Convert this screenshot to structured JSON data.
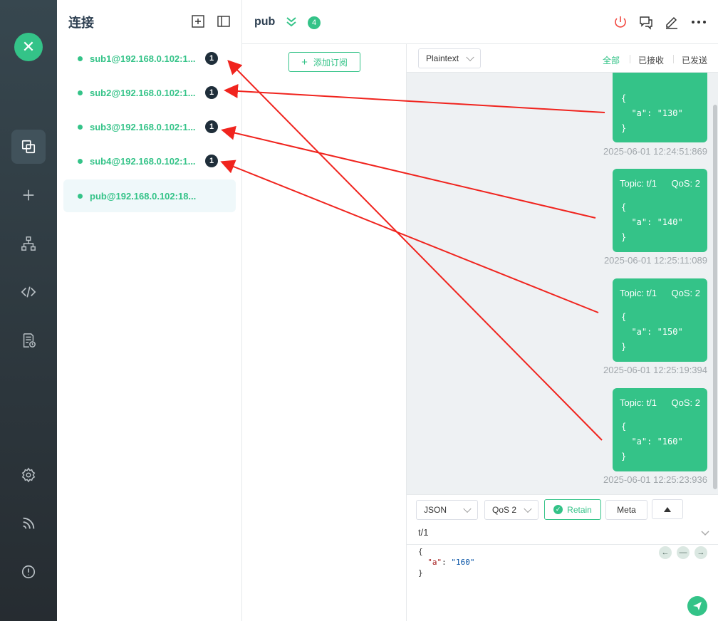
{
  "sidebar": {
    "logo_text": "✕",
    "items": [
      {
        "icon": "connections-icon",
        "active": true
      },
      {
        "icon": "plus-icon"
      },
      {
        "icon": "topology-icon"
      },
      {
        "icon": "code-icon"
      },
      {
        "icon": "log-icon"
      },
      {
        "icon": "gear-icon"
      },
      {
        "icon": "feed-icon"
      },
      {
        "icon": "info-icon"
      }
    ]
  },
  "connections": {
    "title": "连接",
    "items": [
      {
        "name": "sub1@192.168.0.102:1...",
        "unread": "1"
      },
      {
        "name": "sub2@192.168.0.102:1...",
        "unread": "1"
      },
      {
        "name": "sub3@192.168.0.102:1...",
        "unread": "1"
      },
      {
        "name": "sub4@192.168.0.102:1...",
        "unread": "1"
      },
      {
        "name": "pub@192.168.0.102:18...",
        "unread": ""
      }
    ]
  },
  "topbar": {
    "title": "pub",
    "count": "4"
  },
  "subscriptions": {
    "add_label": "添加订阅"
  },
  "filter": {
    "format": "Plaintext",
    "tabs": [
      "全部",
      "已接收",
      "已发送"
    ],
    "active_tab": "全部"
  },
  "messages": [
    {
      "topic": "",
      "qos": "",
      "body": "{\n  \"a\": \"130\"\n}",
      "time": "2025-06-01 12:24:51:869"
    },
    {
      "topic": "Topic: t/1",
      "qos": "QoS: 2",
      "body": "{\n  \"a\": \"140\"\n}",
      "time": "2025-06-01 12:25:11:089"
    },
    {
      "topic": "Topic: t/1",
      "qos": "QoS: 2",
      "body": "{\n  \"a\": \"150\"\n}",
      "time": "2025-06-01 12:25:19:394"
    },
    {
      "topic": "Topic: t/1",
      "qos": "QoS: 2",
      "body": "{\n  \"a\": \"160\"\n}",
      "time": "2025-06-01 12:25:23:936"
    }
  ],
  "composer": {
    "format": "JSON",
    "qos": "QoS 2",
    "retain_label": "Retain",
    "meta_label": "Meta",
    "topic": "t/1",
    "payload_open": "{",
    "payload_key": "\"a\"",
    "payload_colon": ": ",
    "payload_value": "\"160\"",
    "payload_close": "}"
  },
  "colors": {
    "accent": "#34c388",
    "sidebar": "#2f3a40",
    "annotation": "#f0241e"
  }
}
